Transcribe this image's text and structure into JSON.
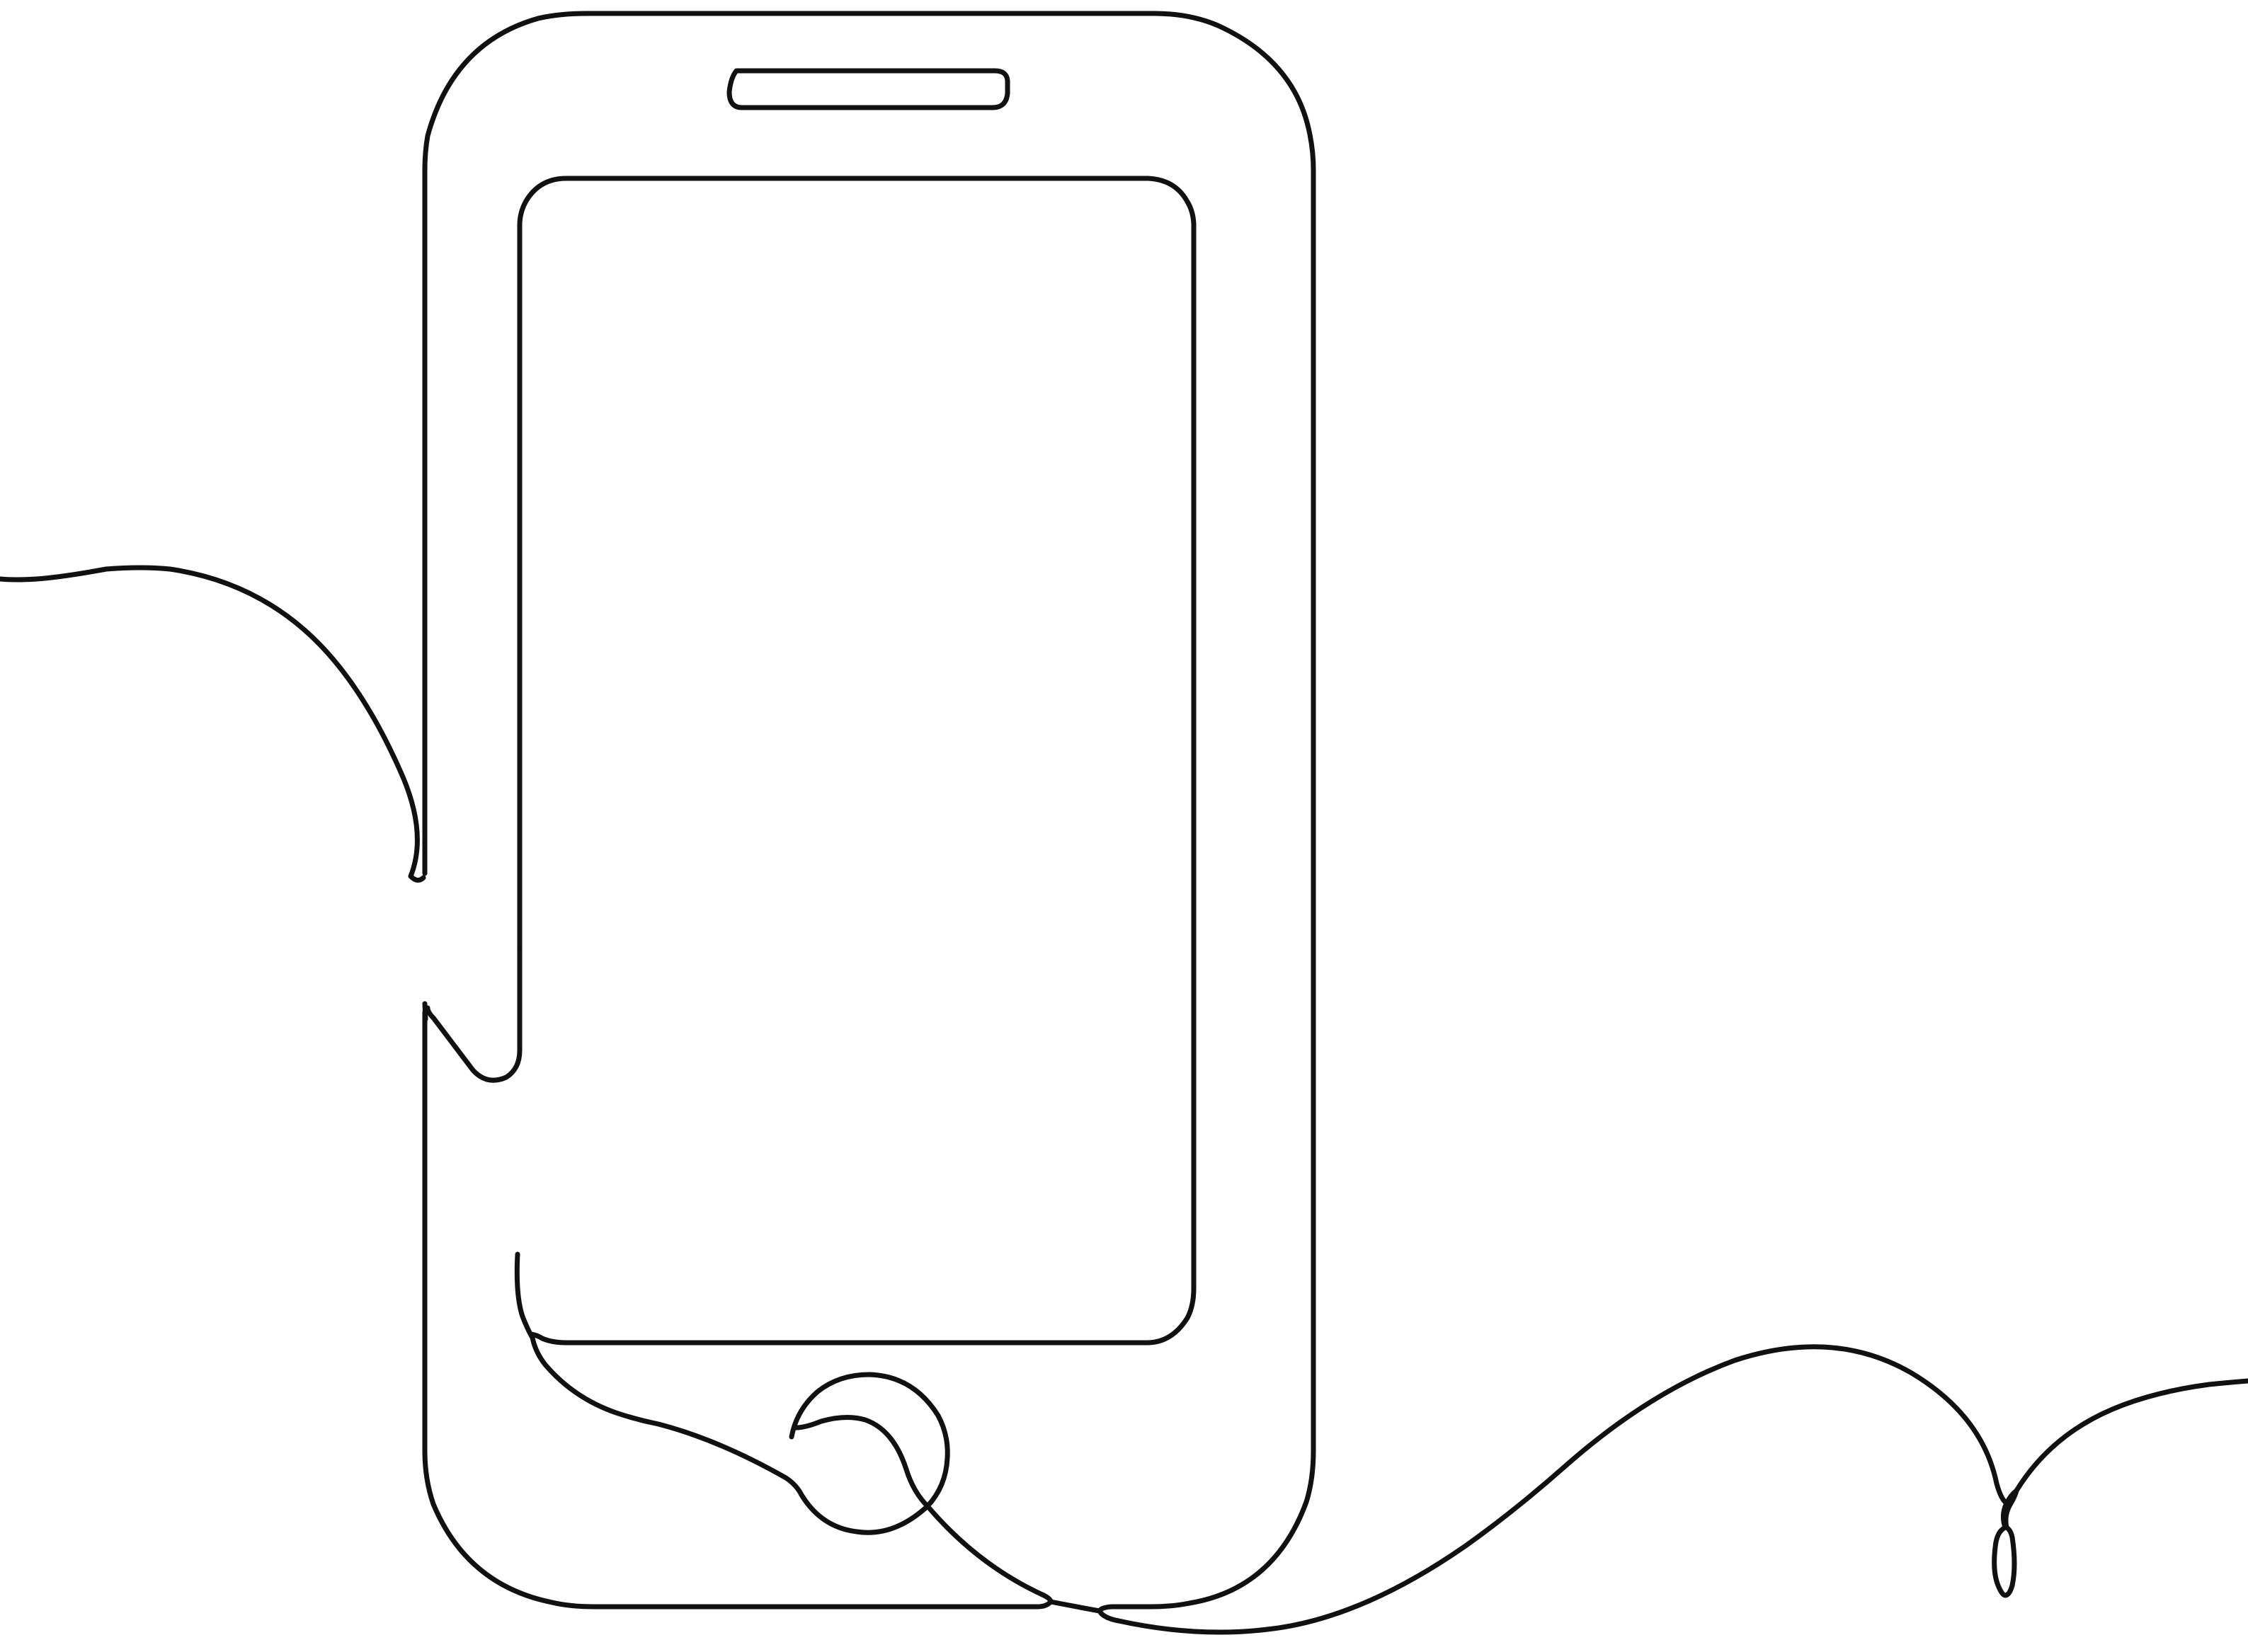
{
  "illustration": {
    "subject": "smartphone-with-earphones",
    "style": "continuous-single-line-drawing",
    "stroke_color": "#111111",
    "background_color": "#ffffff"
  }
}
